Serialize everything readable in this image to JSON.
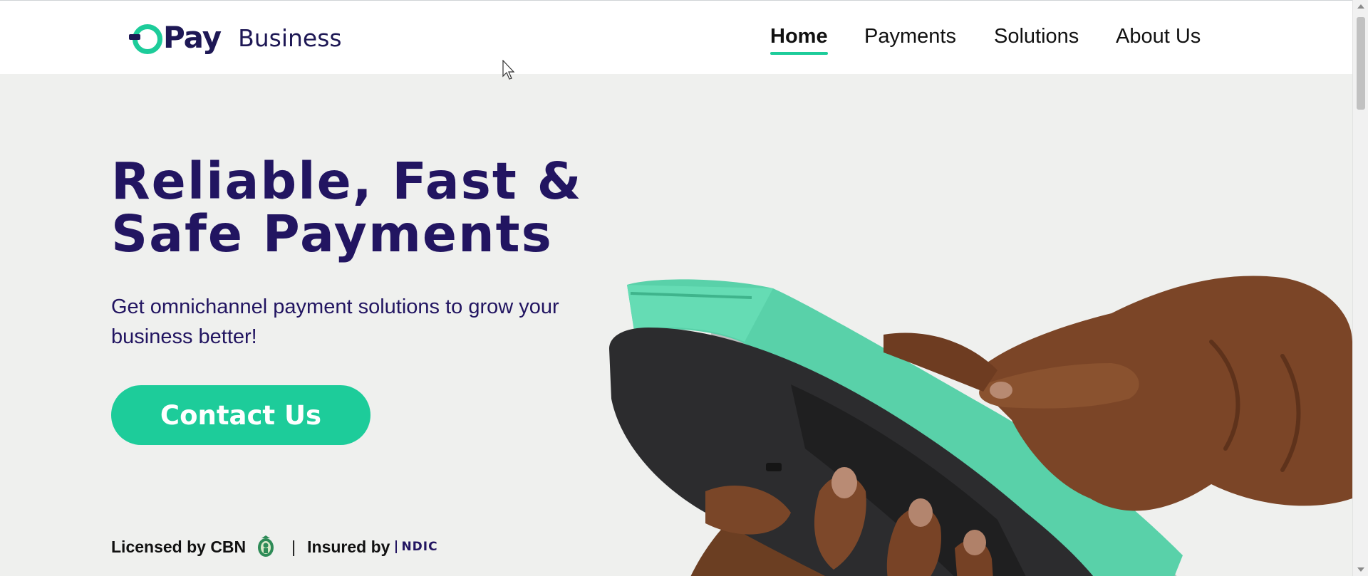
{
  "brand": {
    "logo_text": "Pay",
    "logo_suffix": "Business",
    "color_primary": "#1dcc9a",
    "color_dark": "#221561"
  },
  "nav": {
    "items": [
      {
        "label": "Home",
        "active": true
      },
      {
        "label": "Payments",
        "active": false
      },
      {
        "label": "Solutions",
        "active": false
      },
      {
        "label": "About Us",
        "active": false
      }
    ]
  },
  "hero": {
    "title_line1": "Reliable, Fast &",
    "title_line2": "Safe Payments",
    "subtitle": "Get omnichannel payment solutions to grow your business better!",
    "cta_label": "Contact Us"
  },
  "license": {
    "licensed_text": "Licensed by CBN",
    "separator": "|",
    "insured_text": "Insured by",
    "ndic_text": "NDIC"
  },
  "icons": [
    "opay-logo-icon",
    "cbn-seal-icon",
    "ndic-logo-icon",
    "pos-terminal-hands-image",
    "mouse-cursor-icon"
  ]
}
